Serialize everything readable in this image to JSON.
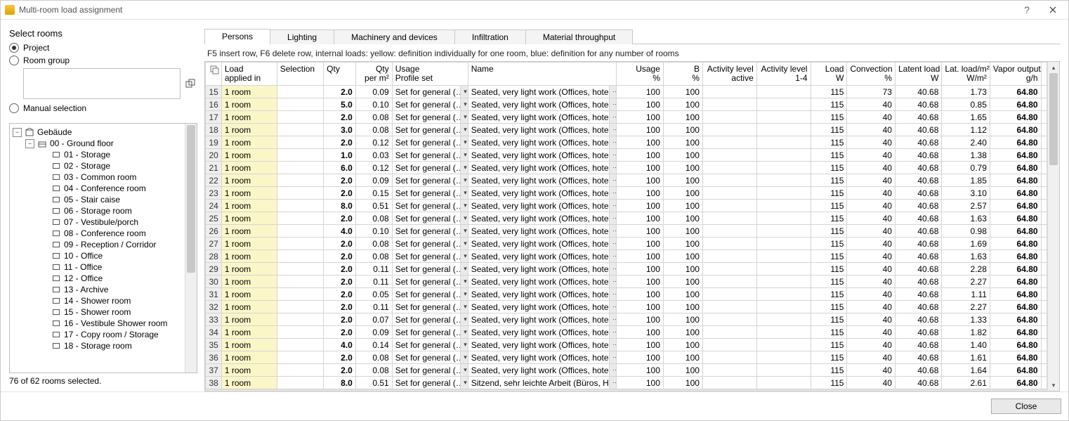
{
  "window": {
    "title": "Multi-room load assignment"
  },
  "left": {
    "section_title": "Select rooms",
    "radio_project": "Project",
    "radio_roomgroup": "Room group",
    "radio_manual": "Manual selection",
    "status": "76 of 62 rooms selected."
  },
  "tree": {
    "building": "Gebäude",
    "floor": "00 - Ground floor",
    "rooms": [
      "01 - Storage",
      "02 - Storage",
      "03 - Common room",
      "04 - Conference room",
      "05 - Stair caise",
      "06 - Storage room",
      "07 - Vestibule/porch",
      "08 - Conference room",
      "09 - Reception / Corridor",
      "10 - Office",
      "11 - Office",
      "12 - Office",
      "13 - Archive",
      "14 - Shower room",
      "15 - Shower room",
      "16 - Vestibule Shower room",
      "17 - Copy room / Storage",
      "18 - Storage room"
    ]
  },
  "tabs": [
    "Persons",
    "Lighting",
    "Machinery and devices",
    "Infiltration",
    "Material throughput"
  ],
  "hint": "F5 insert row, F6 delete row, internal loads: yellow: definition individually for one room, blue: definition for any number of rooms",
  "headers": {
    "applied": "Load\napplied in",
    "selection": "Selection",
    "qty": "Qty",
    "qtym2": "Qty\nper m²",
    "usage": "Usage\nProfile set",
    "name": "Name",
    "usagep": "Usage\n%",
    "bp": "B\n%",
    "actlvl": "Activity level\nactive",
    "act14": "Activity level\n1-4",
    "loadw": "Load\nW",
    "conv": "Convection\n%",
    "latent": "Latent load\nW",
    "latwm2": "Lat. load/m²\nW/m²",
    "vapor": "Vapor output\ng/h"
  },
  "row_defaults": {
    "applied": "1 room",
    "usage": "Set for general (…",
    "name": "Seated, very light work (Offices, hotel…",
    "usagep": "100",
    "bp": "100",
    "loadw": "115",
    "latent": "40.68",
    "vapor": "64.80"
  },
  "rows": [
    {
      "n": 15,
      "qty": "2.0",
      "qtym2": "0.09",
      "conv": "73",
      "latwm2": "1.73"
    },
    {
      "n": 16,
      "qty": "5.0",
      "qtym2": "0.10",
      "conv": "40",
      "latwm2": "0.85"
    },
    {
      "n": 17,
      "qty": "2.0",
      "qtym2": "0.08",
      "conv": "40",
      "latwm2": "1.65"
    },
    {
      "n": 18,
      "qty": "3.0",
      "qtym2": "0.08",
      "conv": "40",
      "latwm2": "1.12"
    },
    {
      "n": 19,
      "qty": "2.0",
      "qtym2": "0.12",
      "conv": "40",
      "latwm2": "2.40"
    },
    {
      "n": 20,
      "qty": "1.0",
      "qtym2": "0.03",
      "conv": "40",
      "latwm2": "1.38"
    },
    {
      "n": 21,
      "qty": "6.0",
      "qtym2": "0.12",
      "conv": "40",
      "latwm2": "0.79"
    },
    {
      "n": 22,
      "qty": "2.0",
      "qtym2": "0.09",
      "conv": "40",
      "latwm2": "1.85"
    },
    {
      "n": 23,
      "qty": "2.0",
      "qtym2": "0.15",
      "conv": "40",
      "latwm2": "3.10"
    },
    {
      "n": 24,
      "qty": "8.0",
      "qtym2": "0.51",
      "conv": "40",
      "latwm2": "2.57"
    },
    {
      "n": 25,
      "qty": "2.0",
      "qtym2": "0.08",
      "conv": "40",
      "latwm2": "1.63"
    },
    {
      "n": 26,
      "qty": "4.0",
      "qtym2": "0.10",
      "conv": "40",
      "latwm2": "0.98"
    },
    {
      "n": 27,
      "qty": "2.0",
      "qtym2": "0.08",
      "conv": "40",
      "latwm2": "1.69"
    },
    {
      "n": 28,
      "qty": "2.0",
      "qtym2": "0.08",
      "conv": "40",
      "latwm2": "1.63"
    },
    {
      "n": 29,
      "qty": "2.0",
      "qtym2": "0.11",
      "conv": "40",
      "latwm2": "2.28"
    },
    {
      "n": 30,
      "qty": "2.0",
      "qtym2": "0.11",
      "conv": "40",
      "latwm2": "2.27"
    },
    {
      "n": 31,
      "qty": "2.0",
      "qtym2": "0.05",
      "conv": "40",
      "latwm2": "1.11"
    },
    {
      "n": 32,
      "qty": "2.0",
      "qtym2": "0.11",
      "conv": "40",
      "latwm2": "2.27"
    },
    {
      "n": 33,
      "qty": "2.0",
      "qtym2": "0.07",
      "conv": "40",
      "latwm2": "1.33"
    },
    {
      "n": 34,
      "qty": "2.0",
      "qtym2": "0.09",
      "conv": "40",
      "latwm2": "1.82"
    },
    {
      "n": 35,
      "qty": "4.0",
      "qtym2": "0.14",
      "conv": "40",
      "latwm2": "1.40"
    },
    {
      "n": 36,
      "qty": "2.0",
      "qtym2": "0.08",
      "conv": "40",
      "latwm2": "1.61"
    },
    {
      "n": 37,
      "qty": "2.0",
      "qtym2": "0.08",
      "conv": "40",
      "latwm2": "1.64"
    },
    {
      "n": 38,
      "qty": "8.0",
      "qtym2": "0.51",
      "conv": "40",
      "latwm2": "2.61",
      "name_override": "Sitzend, sehr leichte Arbeit (Büros, Ho…"
    }
  ],
  "footer": {
    "close": "Close"
  }
}
